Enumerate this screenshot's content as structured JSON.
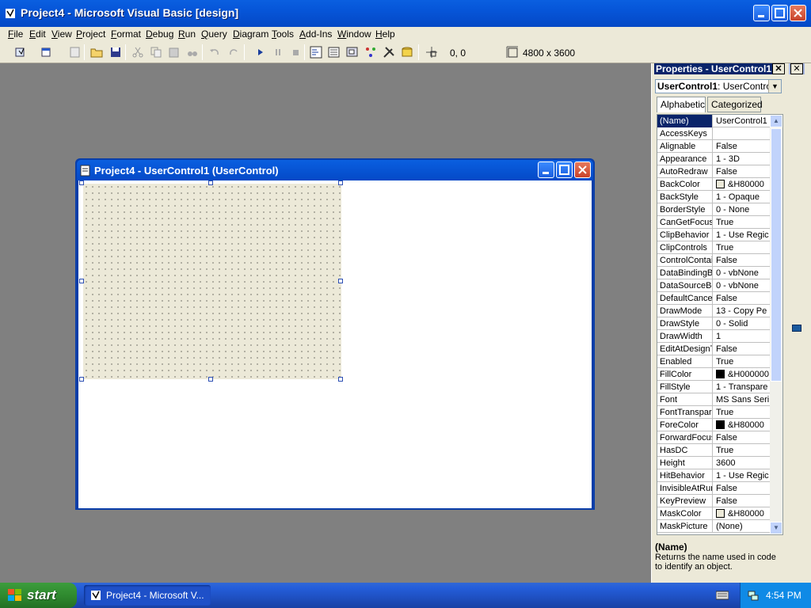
{
  "main_window": {
    "title": "Project4 - Microsoft Visual Basic [design]"
  },
  "menu": [
    "File",
    "Edit",
    "View",
    "Project",
    "Format",
    "Debug",
    "Run",
    "Query",
    "Diagram",
    "Tools",
    "Add-Ins",
    "Window",
    "Help"
  ],
  "toolbar": {
    "position_readout": "0, 0",
    "size_readout": "4800 x 3600"
  },
  "child_window": {
    "title": "Project4 - UserControl1 (UserControl)"
  },
  "properties": {
    "title": "Properties - UserControl1",
    "object_name": "UserControl1",
    "object_type": "UserControl",
    "tabs": [
      "Alphabetic",
      "Categorized"
    ],
    "rows": [
      {
        "name": "(Name)",
        "value": "UserControl1"
      },
      {
        "name": "AccessKeys",
        "value": ""
      },
      {
        "name": "Alignable",
        "value": "False"
      },
      {
        "name": "Appearance",
        "value": "1 - 3D"
      },
      {
        "name": "AutoRedraw",
        "value": "False"
      },
      {
        "name": "BackColor",
        "value": "&H80000",
        "swatch": "#ece9d8"
      },
      {
        "name": "BackStyle",
        "value": "1 - Opaque"
      },
      {
        "name": "BorderStyle",
        "value": "0 - None"
      },
      {
        "name": "CanGetFocus",
        "value": "True"
      },
      {
        "name": "ClipBehavior",
        "value": "1 - Use Regic"
      },
      {
        "name": "ClipControls",
        "value": "True"
      },
      {
        "name": "ControlContair",
        "value": "False"
      },
      {
        "name": "DataBindingBe",
        "value": "0 - vbNone"
      },
      {
        "name": "DataSourceBe",
        "value": "0 - vbNone"
      },
      {
        "name": "DefaultCancel",
        "value": "False"
      },
      {
        "name": "DrawMode",
        "value": "13 - Copy Pe"
      },
      {
        "name": "DrawStyle",
        "value": "0 - Solid"
      },
      {
        "name": "DrawWidth",
        "value": "1"
      },
      {
        "name": "EditAtDesignTi",
        "value": "False"
      },
      {
        "name": "Enabled",
        "value": "True"
      },
      {
        "name": "FillColor",
        "value": "&H000000",
        "swatch": "#000000"
      },
      {
        "name": "FillStyle",
        "value": "1 - Transpare"
      },
      {
        "name": "Font",
        "value": "MS Sans Seri"
      },
      {
        "name": "FontTranspare",
        "value": "True"
      },
      {
        "name": "ForeColor",
        "value": "&H80000",
        "swatch": "#000000"
      },
      {
        "name": "ForwardFocus",
        "value": "False"
      },
      {
        "name": "HasDC",
        "value": "True"
      },
      {
        "name": "Height",
        "value": "3600"
      },
      {
        "name": "HitBehavior",
        "value": "1 - Use Regic"
      },
      {
        "name": "InvisibleAtRun",
        "value": "False"
      },
      {
        "name": "KeyPreview",
        "value": "False"
      },
      {
        "name": "MaskColor",
        "value": "&H80000",
        "swatch": "#ece9d8"
      },
      {
        "name": "MaskPicture",
        "value": "(None)"
      }
    ],
    "description_title": "(Name)",
    "description_text": "Returns the name used in code to identify an object."
  },
  "taskbar": {
    "start_label": "start",
    "task_label": "Project4 - Microsoft V...",
    "clock": "4:54 PM"
  }
}
